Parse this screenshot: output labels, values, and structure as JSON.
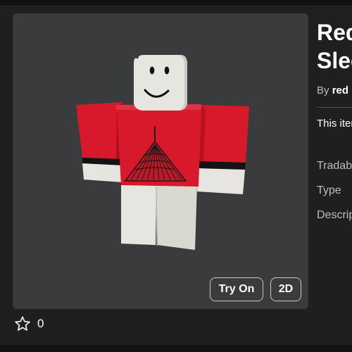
{
  "item": {
    "title_line1": "Red",
    "title_line2": "Sleeves",
    "by_label": "By",
    "creator": "red",
    "description_preview": "This item",
    "meta_labels": [
      "Tradable",
      "Type",
      "Description"
    ]
  },
  "actions": {
    "try_on_label": "Try On",
    "view_2d_label": "2D"
  },
  "favorites": {
    "count": "0",
    "icon": "star-icon"
  },
  "colors": {
    "page_bg": "#1e1f21",
    "thumbnail_bg": "#393b3d",
    "shirt_red": "#d8182b",
    "limb_white": "#e6e5df"
  }
}
